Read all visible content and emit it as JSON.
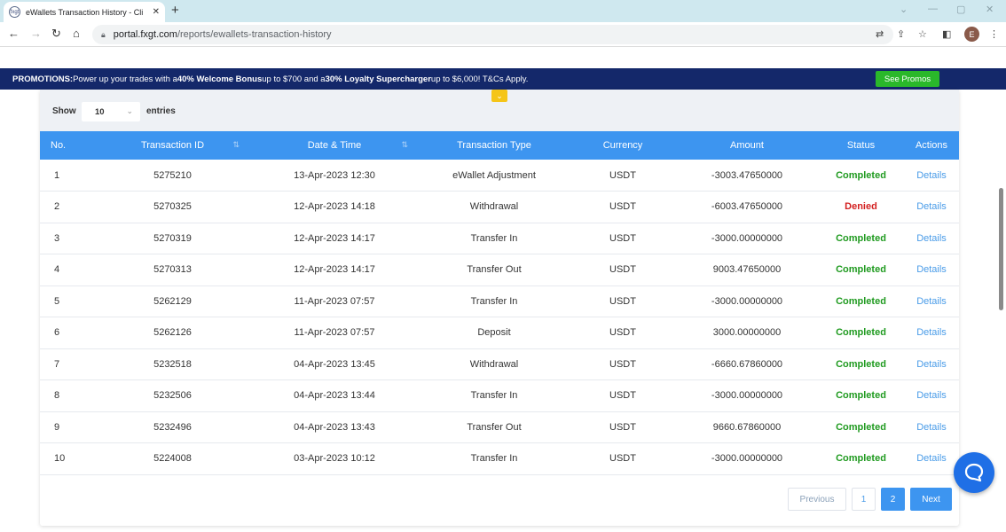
{
  "browser": {
    "tab_title": "eWallets Transaction History - Cli",
    "favicon": "fxgt",
    "url_host": "portal.fxgt.com",
    "url_path": "/reports/ewallets-transaction-history",
    "profile_initial": "E"
  },
  "promo": {
    "prefix": "PROMOTIONS:",
    "t1": " Power up your trades with a ",
    "b1": "40% Welcome Bonus",
    "t2": " up to $700 and a ",
    "b2": "30% Loyalty Supercharger",
    "t3": " up to $6,000! T&Cs Apply.",
    "button": "See Promos"
  },
  "controls": {
    "show_label": "Show",
    "entries_value": "10",
    "entries_label": "entries"
  },
  "table": {
    "headers": [
      "No.",
      "Transaction ID",
      "Date & Time",
      "Transaction Type",
      "Currency",
      "Amount",
      "Status",
      "Actions"
    ],
    "rows": [
      {
        "no": "1",
        "id": "5275210",
        "date": "13-Apr-2023 12:30",
        "type": "eWallet Adjustment",
        "currency": "USDT",
        "amount": "-3003.47650000",
        "status": "Completed",
        "action": "Details"
      },
      {
        "no": "2",
        "id": "5270325",
        "date": "12-Apr-2023 14:18",
        "type": "Withdrawal",
        "currency": "USDT",
        "amount": "-6003.47650000",
        "status": "Denied",
        "action": "Details"
      },
      {
        "no": "3",
        "id": "5270319",
        "date": "12-Apr-2023 14:17",
        "type": "Transfer In",
        "currency": "USDT",
        "amount": "-3000.00000000",
        "status": "Completed",
        "action": "Details"
      },
      {
        "no": "4",
        "id": "5270313",
        "date": "12-Apr-2023 14:17",
        "type": "Transfer Out",
        "currency": "USDT",
        "amount": "9003.47650000",
        "status": "Completed",
        "action": "Details"
      },
      {
        "no": "5",
        "id": "5262129",
        "date": "11-Apr-2023 07:57",
        "type": "Transfer In",
        "currency": "USDT",
        "amount": "-3000.00000000",
        "status": "Completed",
        "action": "Details"
      },
      {
        "no": "6",
        "id": "5262126",
        "date": "11-Apr-2023 07:57",
        "type": "Deposit",
        "currency": "USDT",
        "amount": "3000.00000000",
        "status": "Completed",
        "action": "Details"
      },
      {
        "no": "7",
        "id": "5232518",
        "date": "04-Apr-2023 13:45",
        "type": "Withdrawal",
        "currency": "USDT",
        "amount": "-6660.67860000",
        "status": "Completed",
        "action": "Details"
      },
      {
        "no": "8",
        "id": "5232506",
        "date": "04-Apr-2023 13:44",
        "type": "Transfer In",
        "currency": "USDT",
        "amount": "-3000.00000000",
        "status": "Completed",
        "action": "Details"
      },
      {
        "no": "9",
        "id": "5232496",
        "date": "04-Apr-2023 13:43",
        "type": "Transfer Out",
        "currency": "USDT",
        "amount": "9660.67860000",
        "status": "Completed",
        "action": "Details"
      },
      {
        "no": "10",
        "id": "5224008",
        "date": "03-Apr-2023 10:12",
        "type": "Transfer In",
        "currency": "USDT",
        "amount": "-3000.00000000",
        "status": "Completed",
        "action": "Details"
      }
    ]
  },
  "pagination": {
    "previous": "Previous",
    "page1": "1",
    "page2": "2",
    "next": "Next",
    "current_page": 2
  },
  "colors": {
    "header_blue": "#3d95f0",
    "promo_navy": "#14286a",
    "completed": "#1f9a1f",
    "denied": "#d32020"
  }
}
